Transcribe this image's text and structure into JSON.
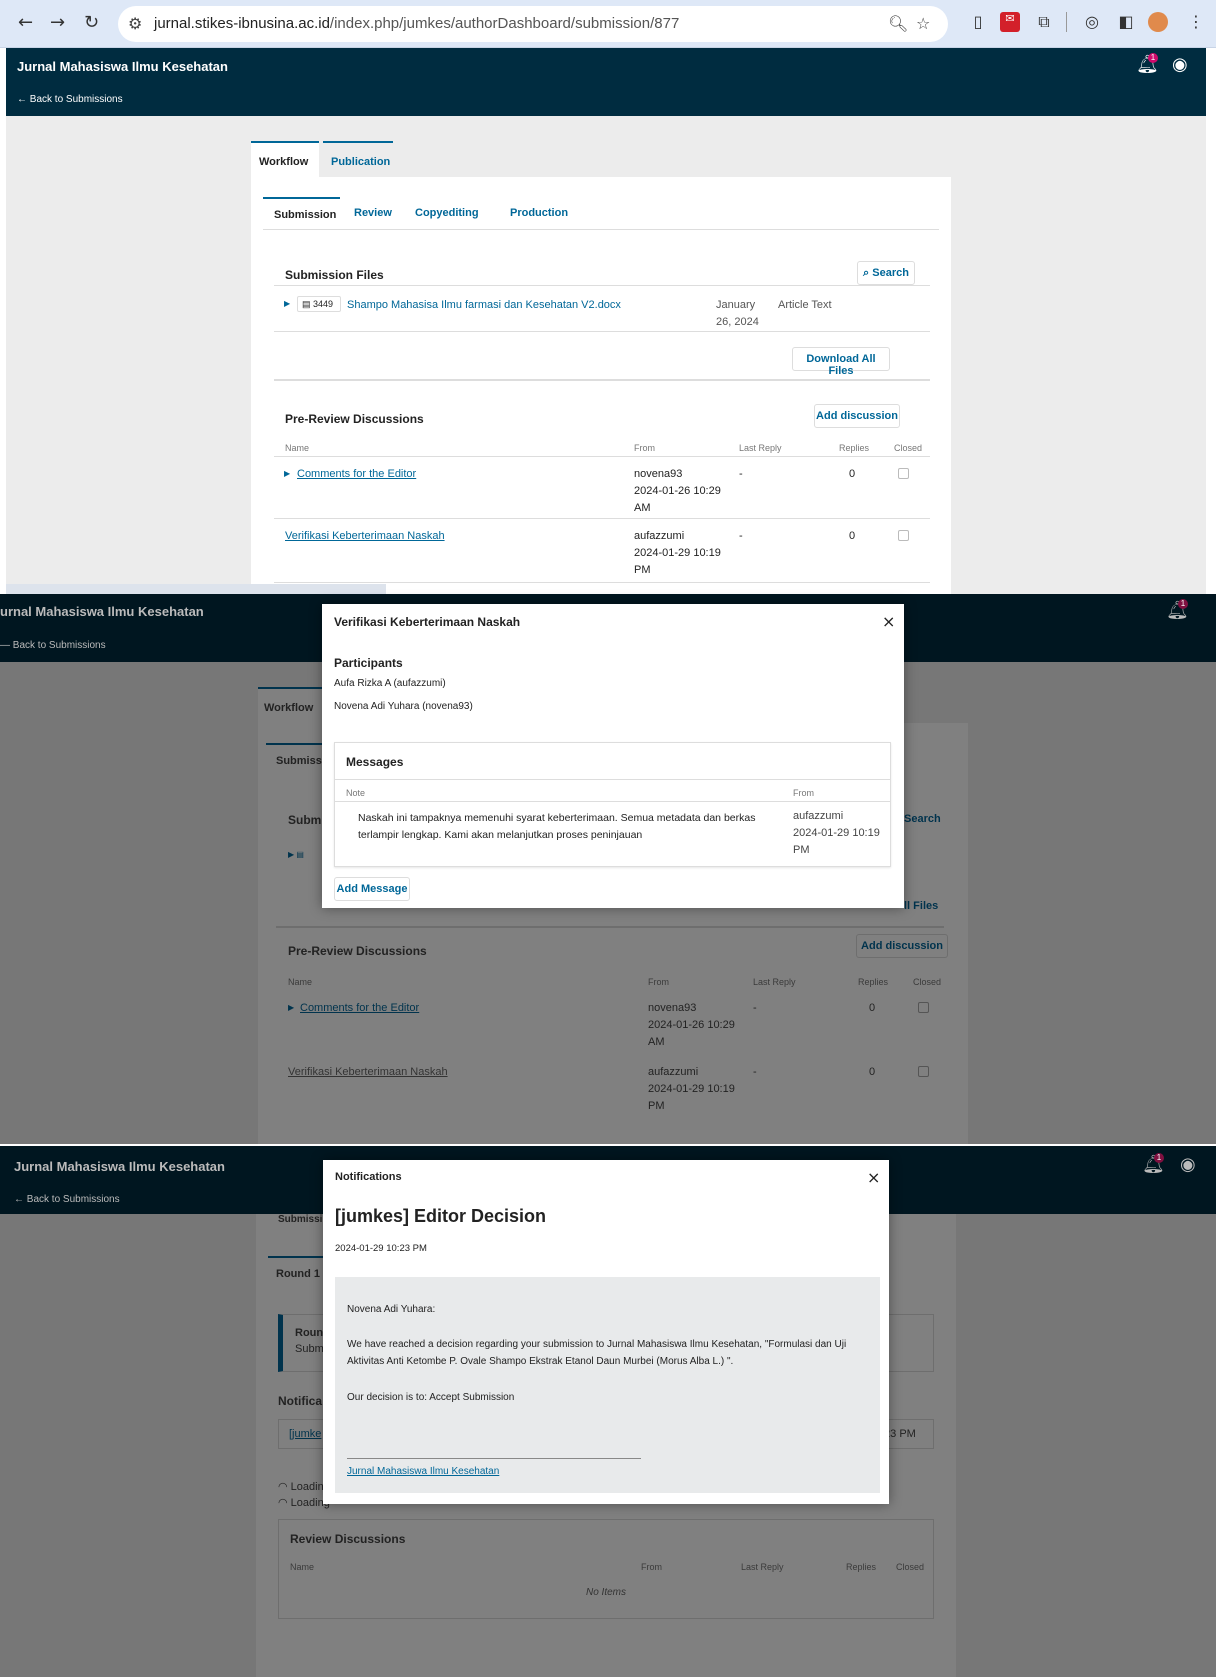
{
  "browser": {
    "url_host": "jurnal.stikes-ibnusina.ac.id",
    "url_path": "/index.php/jumkes/authorDashboard/submission/877"
  },
  "header": {
    "journal_title": "Jurnal Mahasiswa Ilmu Kesehatan",
    "back_link": "← Back to Submissions",
    "notif_count": "1",
    "partial_title": "urnal Mahasiswa Ilmu Kesehatan",
    "partial_back": "— Back to Submissions",
    "back_link3": "← Back to Submissions"
  },
  "tabs": {
    "workflow": "Workflow",
    "publication": "Publication",
    "submission": "Submission",
    "review": "Review",
    "copyediting": "Copyediting",
    "production": "Production",
    "submission_partial": "Submissi",
    "round1": "Round 1",
    "submission_cut3": "Submissi"
  },
  "submission_files": {
    "title": "Submission Files",
    "search": "Search",
    "file_id": "3449",
    "file_name": "Shampo Mahasisa Ilmu farmasi dan Kesehatan V2.docx",
    "date_line1": "January",
    "date_line2": "26, 2024",
    "type": "Article Text",
    "download_all": "Download All Files",
    "title_partial": "Subm",
    "search_partial": "Search",
    "download_partial": "ll Files"
  },
  "pre_review": {
    "title": "Pre-Review Discussions",
    "add": "Add discussion",
    "col_name": "Name",
    "col_from": "From",
    "col_last": "Last Reply",
    "col_replies": "Replies",
    "col_closed": "Closed",
    "rows": [
      {
        "name": "Comments for the Editor",
        "from1": "novena93",
        "from2": "2024-01-26 10:29",
        "from3": "AM",
        "last": "-",
        "replies": "0"
      },
      {
        "name": "Verifikasi Keberterimaan Naskah",
        "from1": "aufazzumi",
        "from2": "2024-01-29 10:19",
        "from3": "PM",
        "last": "-",
        "replies": "0"
      }
    ]
  },
  "modal1": {
    "title": "Verifikasi Keberterimaan Naskah",
    "participants_title": "Participants",
    "participant1": "Aufa Rizka A (aufazzumi)",
    "participant2": "Novena Adi Yuhara (novena93)",
    "messages_title": "Messages",
    "col_note": "Note",
    "col_from": "From",
    "note": "Naskah ini tampaknya memenuhi syarat keberterimaan. Semua metadata dan berkas terlampir lengkap. Kami akan melanjutkan proses peninjauan",
    "from1": "aufazzumi",
    "from2": "2024-01-29 10:19",
    "from3": "PM",
    "add_message": "Add Message"
  },
  "modal2": {
    "title": "Notifications",
    "heading": "[jumkes] Editor Decision",
    "date": "2024-01-29 10:23 PM",
    "salutation": "Novena Adi Yuhara:",
    "body": "We have reached a decision regarding your submission to Jurnal Mahasiswa Ilmu Kesehatan, \"Formulasi dan Uji Aktivitas Anti Ketombe P. Ovale Shampo Ekstrak Etanol Daun Murbei (Morus Alba L.) \".",
    "decision": "Our decision is to: Accept Submission",
    "signature": "Jurnal Mahasiswa Ilmu Kesehatan"
  },
  "screen3": {
    "round_label": "Roun",
    "round_sub": "Subm",
    "notif_title": "Notifica",
    "notif_link": "[jumke",
    "notif_time": ":23 PM",
    "loading1": "Loading",
    "loading2": "Loading",
    "review_title": "Review Discussions",
    "col_name": "Name",
    "col_from": "From",
    "col_last": "Last Reply",
    "col_replies": "Replies",
    "col_closed": "Closed",
    "no_items": "No Items"
  }
}
